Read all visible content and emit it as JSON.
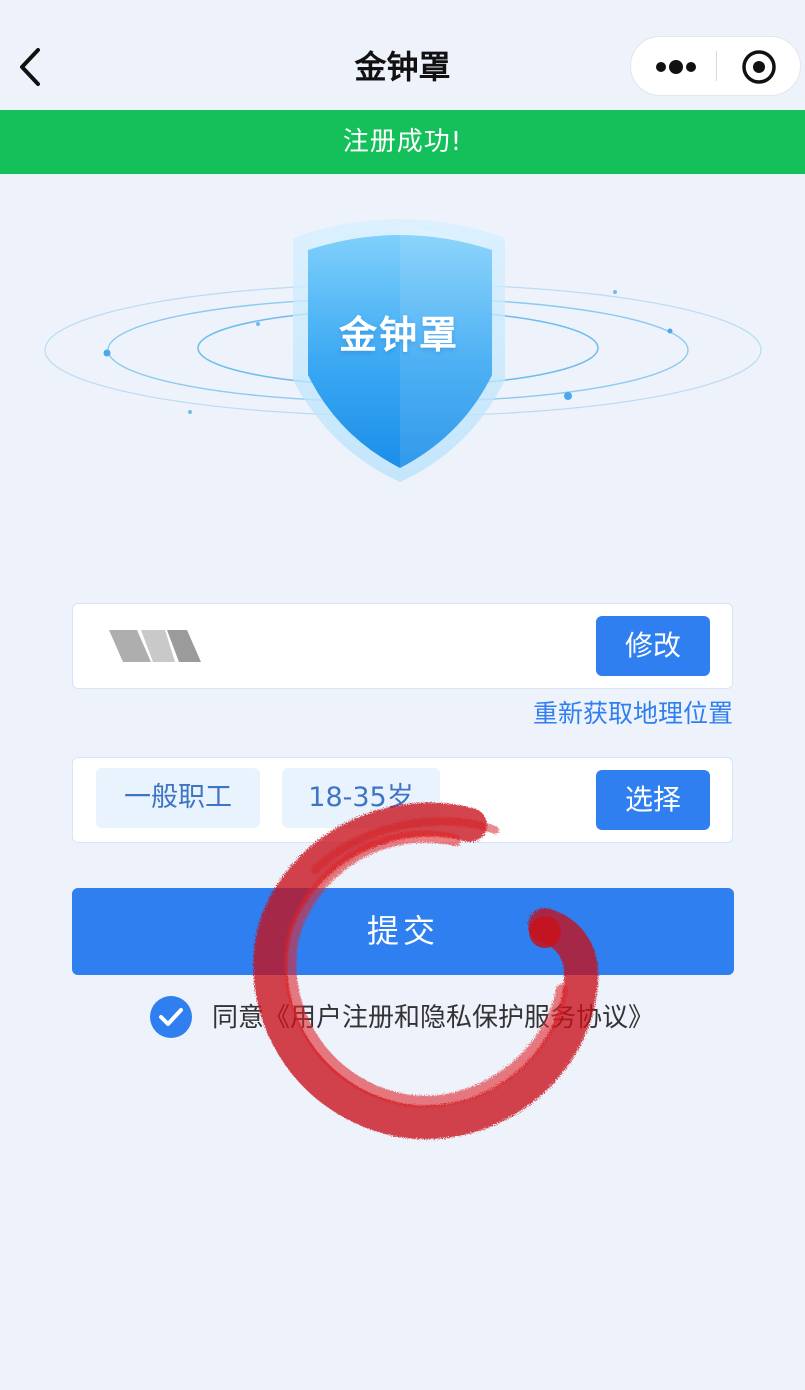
{
  "nav": {
    "title": "金钟罩"
  },
  "banner": {
    "text": "注册成功!"
  },
  "hero": {
    "shield_text": "金钟罩"
  },
  "address_card": {
    "edit_label": "修改",
    "relocate_label": "重新获取地理位置"
  },
  "profile_card": {
    "tags": [
      "一般职工",
      "18-35岁"
    ],
    "select_label": "选择"
  },
  "submit_label": "提交",
  "agreement": {
    "prefix": "同意",
    "link_text": "《用户注册和隐私保护服务协议》",
    "checked": true
  },
  "colors": {
    "primary": "#2f7ff0",
    "success": "#14c05a",
    "background": "#eef2fb"
  }
}
